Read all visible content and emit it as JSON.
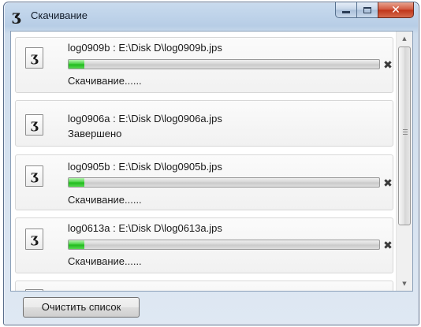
{
  "window": {
    "title": "Скачивание",
    "app_icon_glyph": "ʒ",
    "buttons": {
      "minimize": "minimize",
      "maximize": "maximize",
      "close": "✕"
    }
  },
  "downloads": [
    {
      "file_text": "log0909b : E:\\Disk D\\log0909b.jps",
      "status": "Скачивание......",
      "progress": 0.05,
      "cancel": "✖"
    },
    {
      "file_text": "log0906a : E:\\Disk D\\log0906a.jps",
      "status": "Завершено"
    },
    {
      "file_text": "log0905b : E:\\Disk D\\log0905b.jps",
      "status": "Скачивание......",
      "progress": 0.05,
      "cancel": "✖"
    },
    {
      "file_text": "log0613a : E:\\Disk D\\log0613a.jps",
      "status": "Скачивание......",
      "progress": 0.05,
      "cancel": "✖"
    }
  ],
  "scrollbar": {
    "up": "▲",
    "down": "▼"
  },
  "footer": {
    "clear_button": "Очистить список"
  },
  "colors": {
    "progress_green": "#1fb81c",
    "close_red": "#c9402a"
  }
}
